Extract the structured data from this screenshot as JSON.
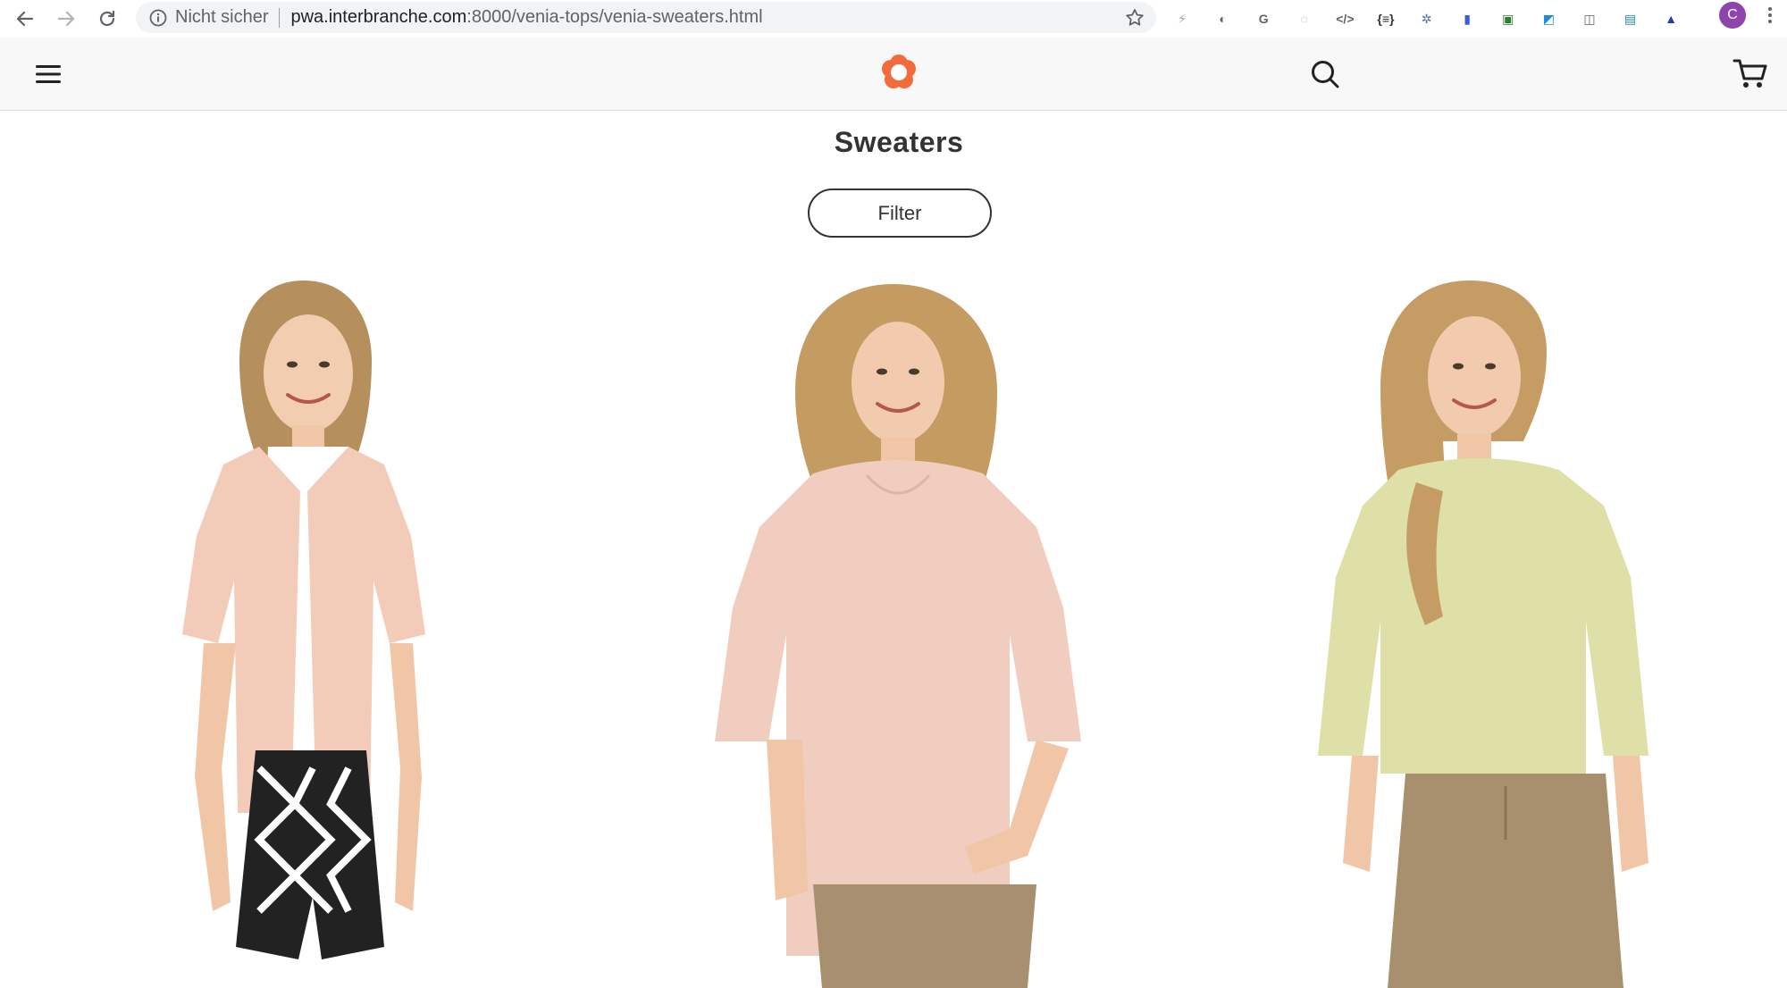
{
  "browser": {
    "security_label": "Nicht sicher",
    "url_host": "pwa.interbranche.com",
    "url_path": ":8000/venia-tops/venia-sweaters.html",
    "profile_initial": "C",
    "extensions": [
      {
        "name": "bolt-extension-icon",
        "glyph": "⚡",
        "color": "#9aa0a6"
      },
      {
        "name": "moon-extension-icon",
        "glyph": "◐",
        "color": "#5f6368"
      },
      {
        "name": "g-extension-icon",
        "glyph": "G",
        "color": "#5f6368"
      },
      {
        "name": "globe-extension-icon",
        "glyph": "◌",
        "color": "#9aa0a6"
      },
      {
        "name": "code-extension-icon",
        "glyph": "</>",
        "color": "#5f6368"
      },
      {
        "name": "braces-extension-icon",
        "glyph": "{≡}",
        "color": "#333333"
      },
      {
        "name": "ufo-extension-icon",
        "glyph": "✲",
        "color": "#4a6fa5"
      },
      {
        "name": "blue-extension-icon",
        "glyph": "▮",
        "color": "#3b5bdb"
      },
      {
        "name": "doc-extension-icon",
        "glyph": "▣",
        "color": "#2e7d32"
      },
      {
        "name": "paint-extension-icon",
        "glyph": "◩",
        "color": "#1e88e5"
      },
      {
        "name": "shelf-extension-icon",
        "glyph": "◫",
        "color": "#5f6368"
      },
      {
        "name": "screen-extension-icon",
        "glyph": "▤",
        "color": "#1e88e5"
      },
      {
        "name": "triangle-extension-icon",
        "glyph": "▲",
        "color": "#1a3fb0"
      }
    ]
  },
  "header": {
    "brand_color": "#f26b3a"
  },
  "page": {
    "title": "Sweaters",
    "filter_label": "Filter"
  },
  "products": [
    {
      "top_color": "#f2cbb9",
      "under_color": "#ffffff",
      "bottom_color": "#222222",
      "hair_color": "#b58f5c"
    },
    {
      "top_color": "#f1cdbf",
      "under_color": "#f1cdbf",
      "bottom_color": "#a88f6f",
      "hair_color": "#c49c62"
    },
    {
      "top_color": "#dfe0a8",
      "under_color": "#dfe0a8",
      "bottom_color": "#a8906f",
      "hair_color": "#c59d64"
    }
  ]
}
